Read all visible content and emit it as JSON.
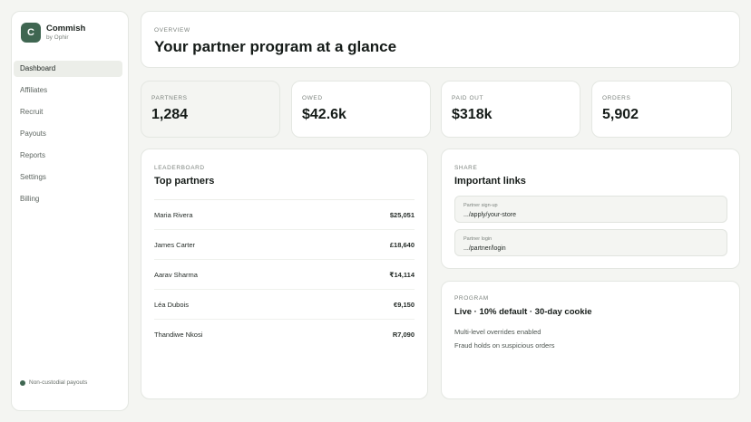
{
  "brand": {
    "logo_letter": "C",
    "name": "Commish",
    "sub": "by Ophir"
  },
  "nav": [
    {
      "label": "Dashboard",
      "active": true
    },
    {
      "label": "Affiliates"
    },
    {
      "label": "Recruit"
    },
    {
      "label": "Payouts"
    },
    {
      "label": "Reports"
    },
    {
      "label": "Settings"
    },
    {
      "label": "Billing"
    }
  ],
  "sidebar_footer": "Non-custodial payouts",
  "header": {
    "eyebrow": "OVERVIEW",
    "title": "Your partner program at a glance"
  },
  "stats": [
    {
      "label": "PARTNERS",
      "value": "1,284"
    },
    {
      "label": "OWED",
      "value": "$42.6k"
    },
    {
      "label": "PAID OUT",
      "value": "$318k"
    },
    {
      "label": "ORDERS",
      "value": "5,902"
    }
  ],
  "leaderboard": {
    "eyebrow": "LEADERBOARD",
    "title": "Top partners",
    "rows": [
      {
        "name": "Maria Rivera",
        "amount": "$25,051"
      },
      {
        "name": "James Carter",
        "amount": "£18,640"
      },
      {
        "name": "Aarav Sharma",
        "amount": "₹14,114"
      },
      {
        "name": "Léa Dubois",
        "amount": "€9,150"
      },
      {
        "name": "Thandiwe Nkosi",
        "amount": "R7,090"
      }
    ]
  },
  "share": {
    "eyebrow": "SHARE",
    "title": "Important links",
    "links": [
      {
        "label": "Partner sign-up",
        "url": ".../apply/your-store"
      },
      {
        "label": "Partner login",
        "url": ".../partner/login"
      }
    ]
  },
  "program": {
    "eyebrow": "PROGRAM",
    "title": "Live · 10% default · 30-day cookie",
    "lines": [
      "Multi-level overrides enabled",
      "Fraud holds on suspicious orders"
    ]
  },
  "colors": {
    "accent": "#3f6651",
    "background": "#f4f5f2",
    "card": "#ffffff"
  }
}
